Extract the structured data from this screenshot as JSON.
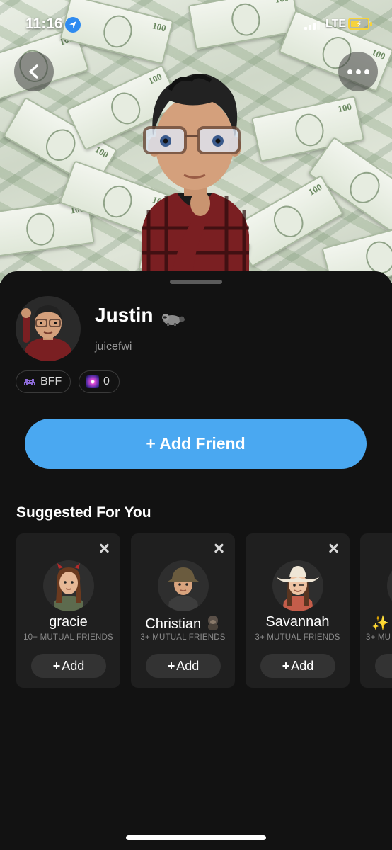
{
  "status_bar": {
    "time": "11:16",
    "network": "LTE"
  },
  "profile": {
    "name": "Justin",
    "name_emoji": "raccoon-emoji",
    "username": "juicefwi",
    "badges": [
      {
        "icon": "alien-monster-icon",
        "label": "BFF"
      },
      {
        "icon": "snap-score-icon",
        "label": "0"
      }
    ]
  },
  "actions": {
    "add_friend_label": "+ Add Friend"
  },
  "suggested": {
    "title": "Suggested For You",
    "cards": [
      {
        "name": "gracie",
        "mutual": "10+ MUTUAL FRIENDS",
        "add_label": "Add"
      },
      {
        "name": "Christian",
        "mutual": "3+ MUTUAL FRIENDS",
        "add_label": "Add"
      },
      {
        "name": "Savannah",
        "mutual": "3+ MUTUAL FRIENDS",
        "add_label": "Add"
      },
      {
        "name": "✨",
        "mutual": "3+ MU",
        "add_label": ""
      }
    ]
  },
  "colors": {
    "accent": "#4aa8f1",
    "background": "#121212",
    "card": "#1f1f1f"
  }
}
